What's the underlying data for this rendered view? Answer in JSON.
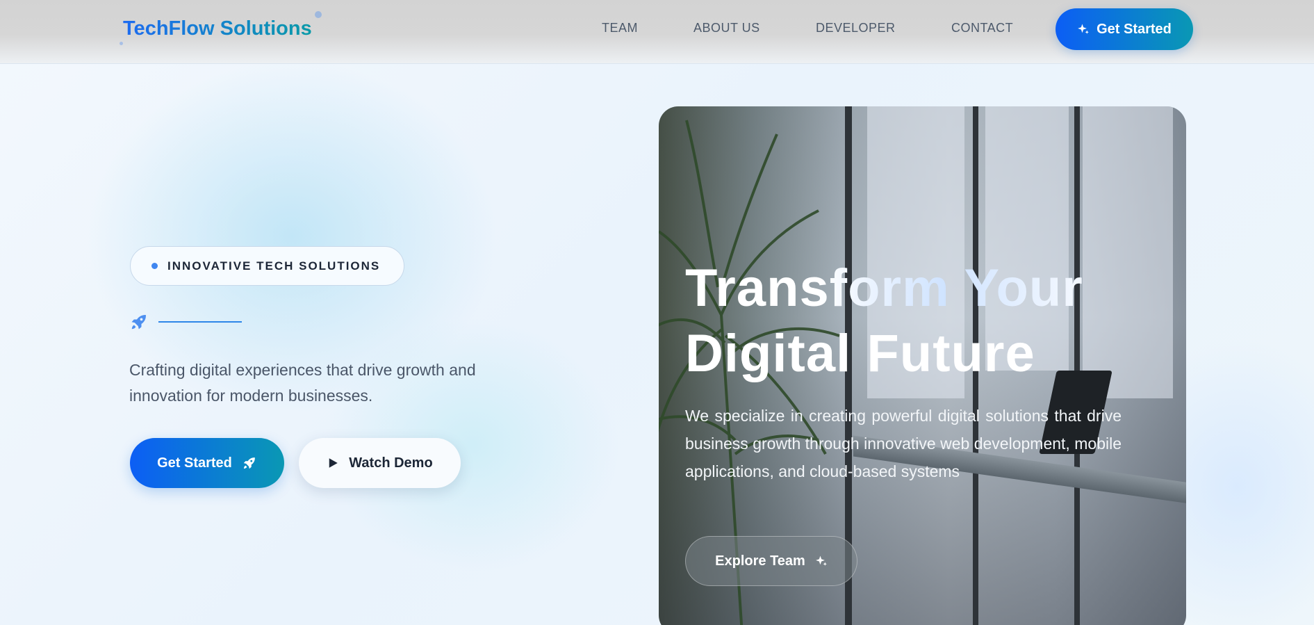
{
  "header": {
    "brand": "TechFlow Solutions",
    "nav": [
      "TEAM",
      "ABOUT US",
      "DEVELOPER",
      "CONTACT"
    ],
    "cta_label": "Get Started"
  },
  "hero": {
    "badge": "INNOVATIVE TECH SOLUTIONS",
    "subtitle": "Crafting digital experiences that drive growth and innovation for modern businesses.",
    "primary_button": "Get Started",
    "secondary_button": "Watch Demo"
  },
  "card": {
    "title_line1": "Transform Your",
    "title_line2": "Digital Future",
    "description": "We specialize in creating powerful digital solutions that drive business growth through innovative web development, mobile applications, and cloud-based systems",
    "button": "Explore Team"
  },
  "colors": {
    "accent_start": "#0c5ef5",
    "accent_end": "#0a98b4",
    "text_dark": "#1c2636"
  },
  "icons": {
    "header_cta": "sparkles-icon",
    "rocket": "rocket-icon",
    "play": "play-icon",
    "explore": "sparkles-icon"
  }
}
